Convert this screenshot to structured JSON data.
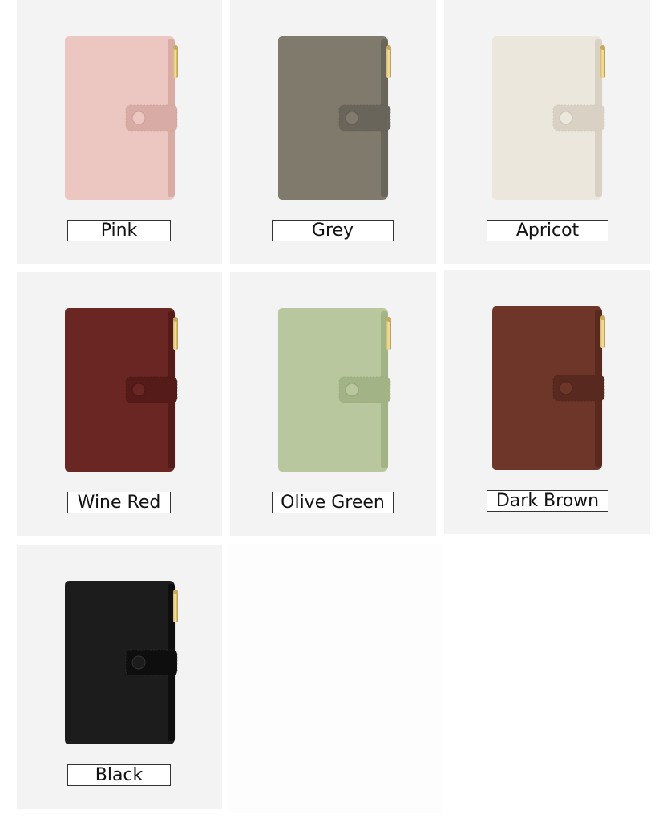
{
  "swatches": [
    {
      "label": "Pink",
      "body": "#ecc7c1",
      "dark": "#d8aba4",
      "stitch": "#c99c95"
    },
    {
      "label": "Grey",
      "body": "#7f7a6c",
      "dark": "#6a655a",
      "stitch": "#5f5b50"
    },
    {
      "label": "Apricot",
      "body": "#ece7dc",
      "dark": "#d9d2c4",
      "stitch": "#c9c1b1"
    },
    {
      "label": "Wine Red",
      "body": "#6a2623",
      "dark": "#551b19",
      "stitch": "#4a1614"
    },
    {
      "label": "Olive Green",
      "body": "#b8c79d",
      "dark": "#a2b386",
      "stitch": "#92a476"
    },
    {
      "label": "Dark Brown",
      "body": "#6d3628",
      "dark": "#58291e",
      "stitch": "#4c2319"
    },
    {
      "label": "Black",
      "body": "#1c1c1c",
      "dark": "#0e0e0e",
      "stitch": "#333333"
    }
  ]
}
